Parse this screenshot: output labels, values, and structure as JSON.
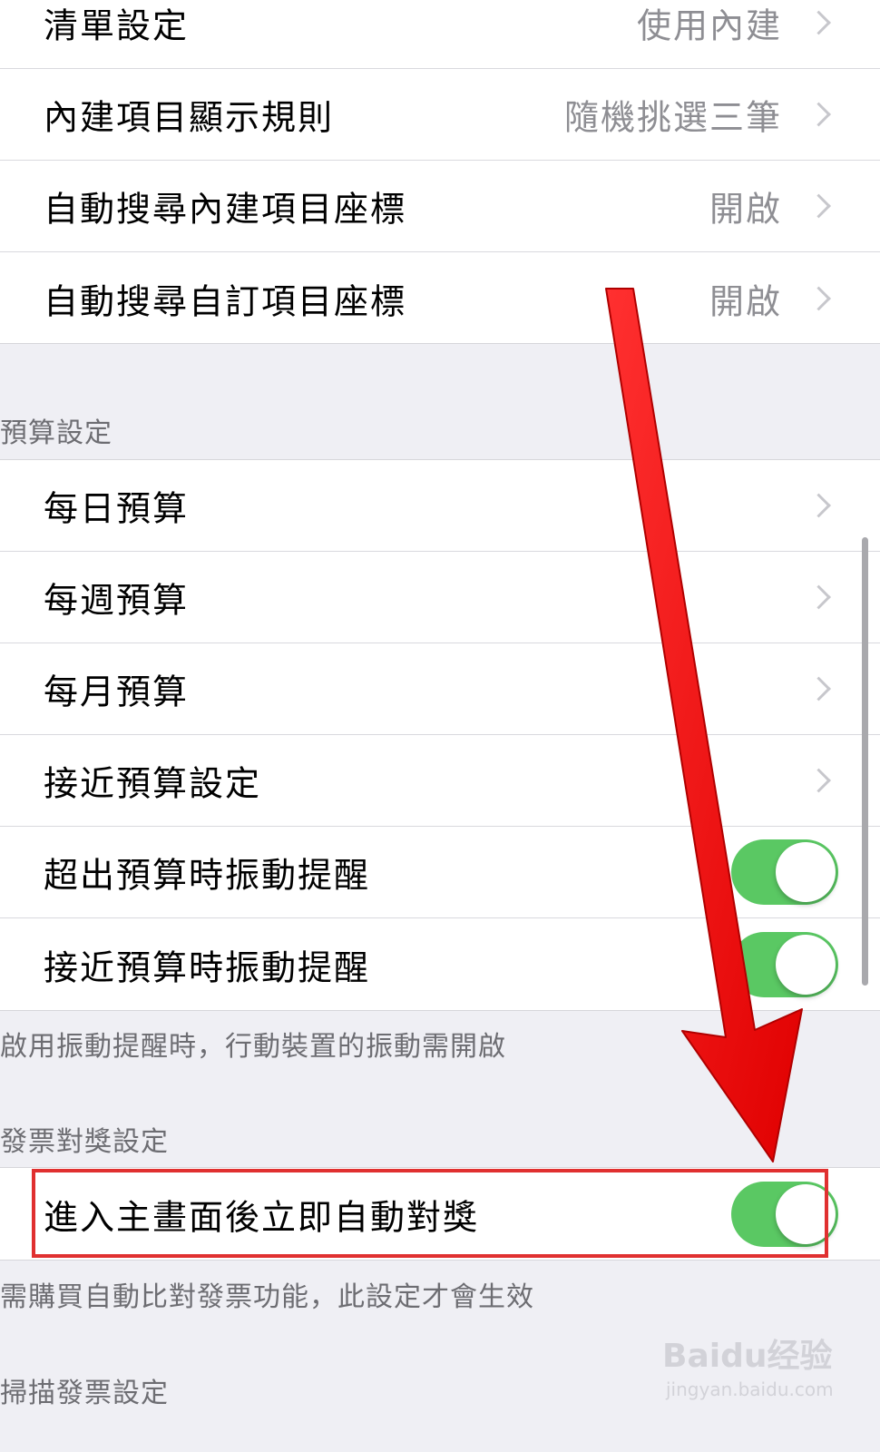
{
  "list_settings": {
    "rows": [
      {
        "label": "清單設定",
        "value": "使用內建"
      },
      {
        "label": "內建項目顯示規則",
        "value": "隨機挑選三筆"
      },
      {
        "label": "自動搜尋內建項目座標",
        "value": "開啟"
      },
      {
        "label": "自動搜尋自訂項目座標",
        "value": "開啟"
      }
    ]
  },
  "budget_settings": {
    "header": "預算設定",
    "rows": [
      {
        "label": "每日預算"
      },
      {
        "label": "每週預算"
      },
      {
        "label": "每月預算"
      },
      {
        "label": "接近預算設定"
      },
      {
        "label": "超出預算時振動提醒",
        "toggle_on": true
      },
      {
        "label": "接近預算時振動提醒",
        "toggle_on": true
      }
    ],
    "footer": "啟用振動提醒時，行動裝置的振動需開啟"
  },
  "invoice_settings": {
    "header": "發票對獎設定",
    "rows": [
      {
        "label": "進入主畫面後立即自動對獎",
        "toggle_on": true
      }
    ],
    "footer": "需購買自動比對發票功能，此設定才會生效"
  },
  "scan_settings": {
    "header": "掃描發票設定"
  },
  "icons": {
    "chevron": "chevron-right-icon",
    "annotation": "red-arrow-annotation"
  },
  "colors": {
    "toggle_on": "#5ac863",
    "annotation_red": "#ff1a1a",
    "highlight_border": "#e03030",
    "background": "#efeff4"
  },
  "watermark": {
    "brand": "Baidu经验",
    "url": "jingyan.baidu.com"
  }
}
